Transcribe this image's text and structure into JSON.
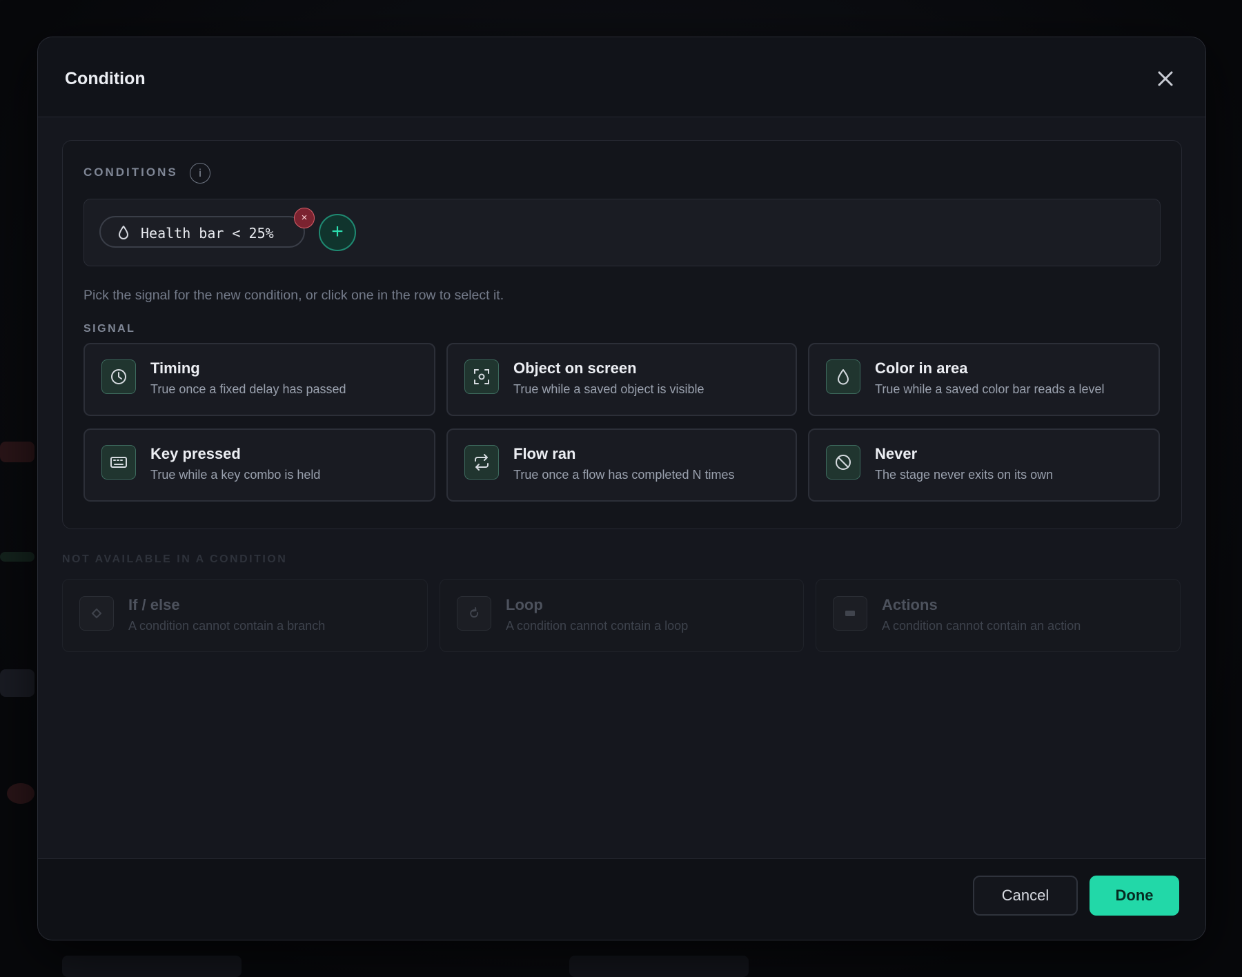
{
  "modal": {
    "title": "Condition"
  },
  "conditions": {
    "section_label": "CONDITIONS",
    "info_glyph": "i",
    "chips": [
      {
        "icon": "drop-icon",
        "label": "Health bar < 25%",
        "remove_glyph": "×"
      }
    ],
    "add_glyph": "+",
    "hint": "Pick the signal for the new condition, or click one in the row to select it."
  },
  "signal": {
    "section_label": "SIGNAL",
    "cards": [
      {
        "icon": "clock-icon",
        "title": "Timing",
        "desc": "True once a fixed delay has passed"
      },
      {
        "icon": "scan-icon",
        "title": "Object on screen",
        "desc": "True while a saved object is visible"
      },
      {
        "icon": "drop-icon",
        "title": "Color in area",
        "desc": "True while a saved color bar reads a level"
      },
      {
        "icon": "keyboard-icon",
        "title": "Key pressed",
        "desc": "True while a key combo is held"
      },
      {
        "icon": "repeat-icon",
        "title": "Flow ran",
        "desc": "True once a flow has completed N times"
      },
      {
        "icon": "ban-icon",
        "title": "Never",
        "desc": "The stage never exits on its own"
      }
    ]
  },
  "unavailable": {
    "section_label": "NOT AVAILABLE IN A CONDITION",
    "cards": [
      {
        "icon": "diamond-icon",
        "title": "If / else",
        "desc": "A condition cannot contain a branch"
      },
      {
        "icon": "loop-icon",
        "title": "Loop",
        "desc": "A condition cannot contain a loop"
      },
      {
        "icon": "action-icon",
        "title": "Actions",
        "desc": "A condition cannot contain an action"
      }
    ]
  },
  "footer": {
    "cancel_label": "Cancel",
    "done_label": "Done"
  },
  "colors": {
    "accent": "#22d8a8",
    "danger": "#d9606a",
    "surface": "#15171e"
  }
}
